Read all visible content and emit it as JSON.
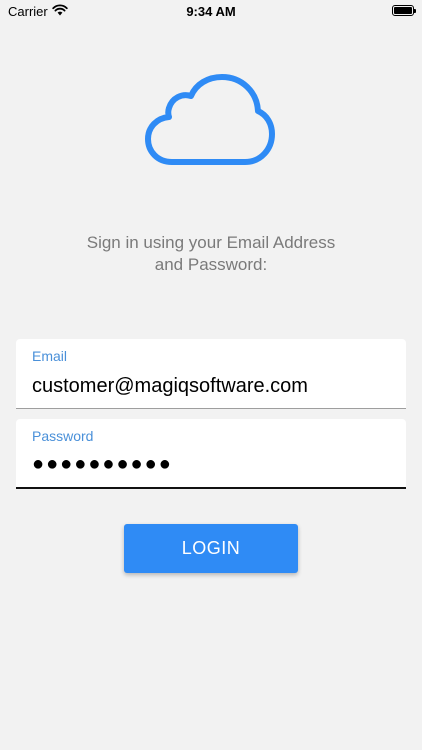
{
  "status_bar": {
    "carrier": "Carrier",
    "time": "9:34 AM",
    "wifi_icon": "wifi-icon",
    "battery_icon": "battery-icon"
  },
  "logo": {
    "icon": "cloud-icon",
    "color": "#2f8bf5"
  },
  "instruction": {
    "line1": "Sign in using your Email Address",
    "line2": "and Password:"
  },
  "email_field": {
    "label": "Email",
    "value": "customer@magiqsoftware.com"
  },
  "password_field": {
    "label": "Password",
    "masked_value": "●●●●●●●●●●"
  },
  "login_button": {
    "label": "LOGIN",
    "color": "#2f8bf5"
  }
}
